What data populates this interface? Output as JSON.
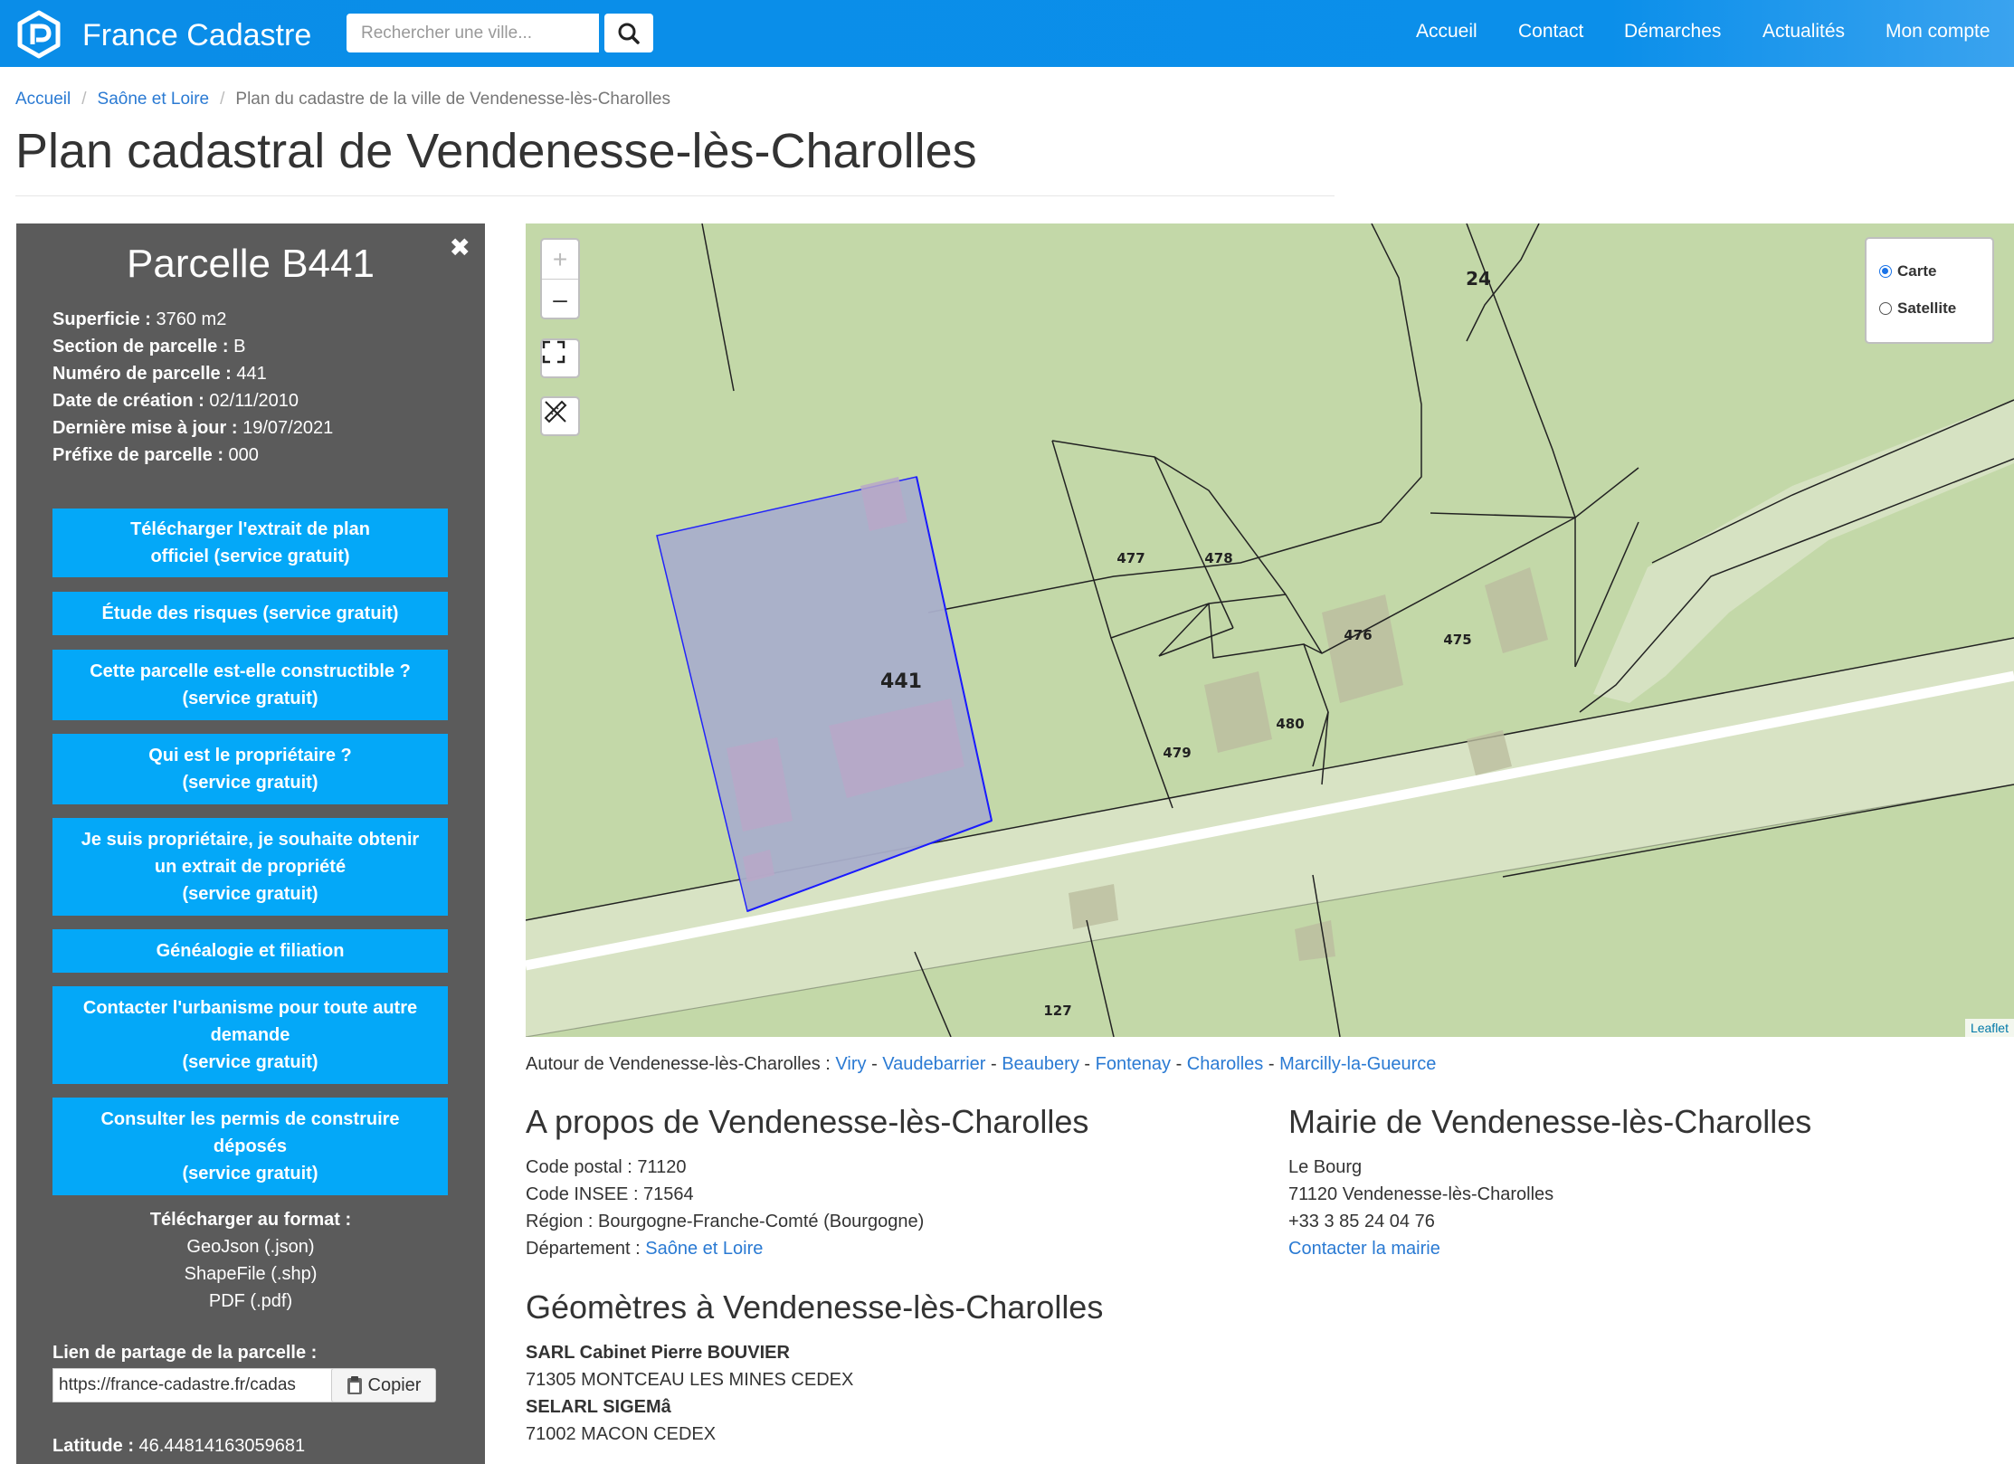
{
  "navbar": {
    "brand": "France Cadastre",
    "search_placeholder": "Rechercher une ville...",
    "links": [
      "Accueil",
      "Contact",
      "Démarches",
      "Actualités",
      "Mon compte"
    ]
  },
  "breadcrumb": [
    "Accueil",
    "Saône et Loire",
    "Plan du cadastre de la ville de Vendenesse-lès-Charolles"
  ],
  "page_title": "Plan cadastral de Vendenesse-lès-Charolles",
  "parcel": {
    "title": "Parcelle B441",
    "close_glyph": "✖",
    "infos": [
      {
        "label": "Superficie :",
        "value": " 3760 m2"
      },
      {
        "label": "Section de parcelle :",
        "value": " B"
      },
      {
        "label": "Numéro de parcelle :",
        "value": " 441"
      },
      {
        "label": "Date de création :",
        "value": " 02/11/2010"
      },
      {
        "label": "Dernière mise à jour :",
        "value": " 19/07/2021"
      },
      {
        "label": "Préfixe de parcelle :",
        "value": " 000"
      }
    ],
    "buttons": [
      {
        "line1": "Télécharger l'extrait de plan",
        "line2": "officiel (service gratuit)",
        "line3": ""
      },
      {
        "line1": "Étude des risques (service gratuit)",
        "line2": "",
        "line3": ""
      },
      {
        "line1": "Cette parcelle est-elle constructible ?",
        "line2": "(service gratuit)",
        "line3": ""
      },
      {
        "line1": "Qui est le propriétaire ?",
        "line2": "(service gratuit)",
        "line3": ""
      },
      {
        "line1": "Je suis propriétaire, je souhaite obtenir",
        "line2": "un extrait de propriété",
        "line3": "(service gratuit)"
      },
      {
        "line1": "Généalogie et filiation",
        "line2": "",
        "line3": ""
      },
      {
        "line1": "Contacter l'urbanisme pour toute autre",
        "line2": "demande",
        "line3": "(service gratuit)"
      },
      {
        "line1": "Consulter les permis de construire",
        "line2": "déposés",
        "line3": "(service gratuit)"
      }
    ],
    "download_title": "Télécharger au format :",
    "downloads": [
      "GeoJson (.json)",
      "ShapeFile (.shp)",
      "PDF (.pdf)"
    ],
    "share_label": "Lien de partage de la parcelle :",
    "share_url": "https://france-cadastre.fr/cadas",
    "copy_label": "Copier",
    "latitude_label": "Latitude :",
    "latitude_value": " 46.44814163059681"
  },
  "map": {
    "zoom_in": "+",
    "zoom_out": "–",
    "layers": [
      {
        "label": "Carte",
        "selected": true
      },
      {
        "label": "Satellite",
        "selected": false
      }
    ],
    "attribution": "Leaflet",
    "parcel_labels": [
      "24",
      "441",
      "477",
      "478",
      "476",
      "475",
      "480",
      "479",
      "127"
    ]
  },
  "nearby": {
    "prefix": "Autour de Vendenesse-lès-Charolles : ",
    "towns": [
      "Viry",
      "Vaudebarrier",
      "Beaubery",
      "Fontenay",
      "Charolles",
      "Marcilly-la-Gueurce"
    ],
    "separator": " - "
  },
  "about": {
    "title": "A propos de Vendenesse-lès-Charolles",
    "code_postal": "Code postal : 71120",
    "code_insee": "Code INSEE : 71564",
    "region": "Région : Bourgogne-Franche-Comté (Bourgogne)",
    "departement_label": "Département : ",
    "departement_link": "Saône et Loire"
  },
  "mairie": {
    "title": "Mairie de Vendenesse-lès-Charolles",
    "address1": "Le Bourg",
    "address2": "71120 Vendenesse-lès-Charolles",
    "phone": "+33 3 85 24 04 76",
    "contact_link": "Contacter la mairie"
  },
  "geometres": {
    "title": "Géomètres à Vendenesse-lès-Charolles",
    "entries": [
      {
        "name": "SARL Cabinet Pierre BOUVIER",
        "address": "71305 MONTCEAU LES MINES  CEDEX"
      },
      {
        "name": "SELARL SIGEMâ",
        "address": "71002 MACON  CEDEX"
      }
    ]
  },
  "colors": {
    "navbar": "#0a8de8",
    "panel": "#5b5b5b",
    "button": "#04a8f8",
    "link": "#2a7ad3",
    "map_green": "#c3d8a8",
    "selected_parcel": "#a9afcb"
  }
}
